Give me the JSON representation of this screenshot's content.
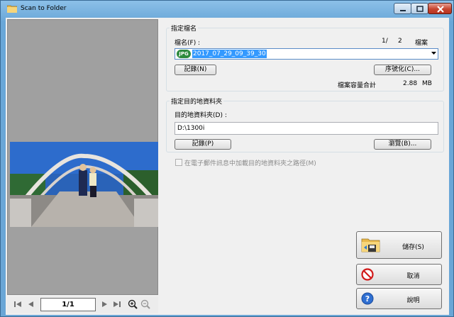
{
  "window": {
    "title": "Scan to Folder"
  },
  "file_name_group": {
    "title": "指定檔名",
    "label": "檔名(F) :",
    "page_current": "1/",
    "page_total": "2",
    "page_unit": "檔案",
    "file_type_badge": "JPG",
    "file_name_value": "2017_07_29_09_39_30",
    "record_button": "記錄(N)",
    "serialize_button": "序號化(C)...",
    "size_label": "檔案容量合計",
    "size_value": "2.88",
    "size_unit": "MB"
  },
  "folder_group": {
    "title": "指定目的地資料夾",
    "label": "目的地資料夾(D) :",
    "path_value": "D:\\1300i",
    "record_button": "記錄(P)",
    "browse_button": "瀏覽(B)..."
  },
  "email_checkbox": {
    "label": "在電子郵件訊息中加載目的地資料夾之路徑(M)",
    "checked": false,
    "enabled": false
  },
  "actions": {
    "save": "儲存(S)",
    "cancel": "取消",
    "help": "說明"
  },
  "preview_nav": {
    "page": "1/1"
  },
  "colors": {
    "accent": "#3399ff",
    "titlebar": "#6aa7d6",
    "close": "#c7452f",
    "jpg_badge": "#2c8a3e"
  }
}
